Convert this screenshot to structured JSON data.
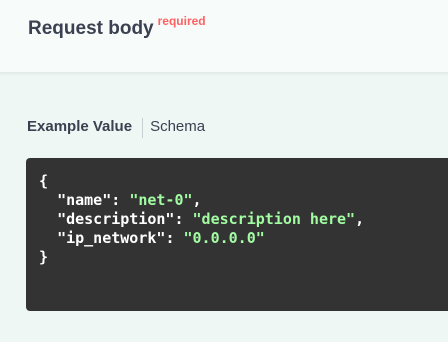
{
  "request_body": {
    "title": "Request body",
    "required_label": "required"
  },
  "tabs": {
    "example_value": "Example Value",
    "schema": "Schema"
  },
  "example": {
    "open_brace": "{",
    "close_brace": "}",
    "lines": [
      {
        "key": "\"name\"",
        "value": "\"net-0\"",
        "trailing": ","
      },
      {
        "key": "\"description\"",
        "value": "\"description here\"",
        "trailing": ","
      },
      {
        "key": "\"ip_network\"",
        "value": "\"0.0.0.0\"",
        "trailing": ""
      }
    ],
    "indent": "  ",
    "separator": ": "
  },
  "colors": {
    "required": "#ff6060",
    "code_background": "#333333",
    "string": "#a2fca2",
    "page_background": "#eef7f4"
  }
}
